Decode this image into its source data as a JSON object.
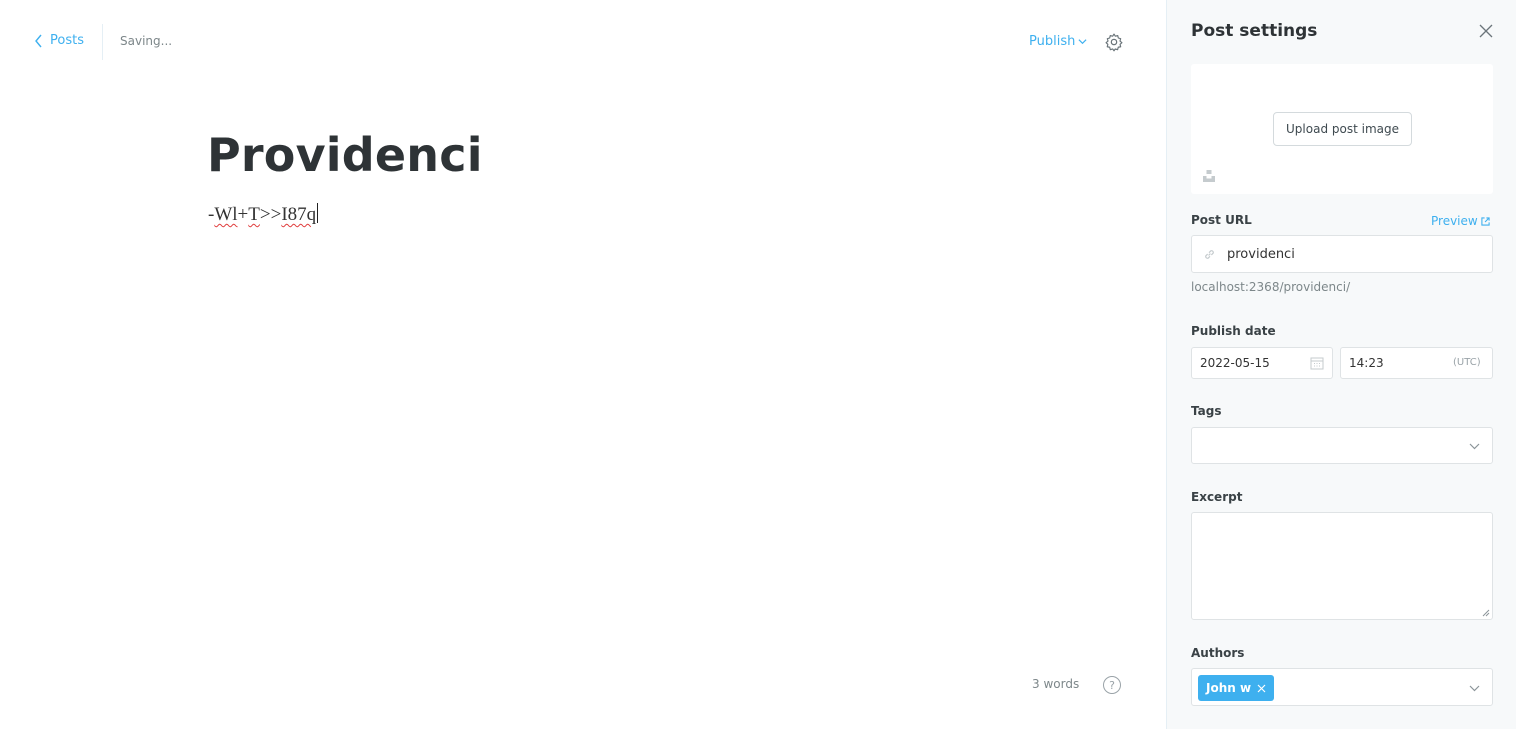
{
  "header": {
    "back_label": "Posts",
    "status": "Saving...",
    "publish_label": "Publish"
  },
  "post": {
    "title": "Providenci",
    "body_parts": [
      "-",
      "Wl",
      "+",
      "T",
      ">>",
      "I87q"
    ]
  },
  "footer": {
    "word_count": "3 words",
    "help_glyph": "?"
  },
  "settings": {
    "title": "Post settings",
    "upload_label": "Upload post image",
    "url_label": "Post URL",
    "preview_label": "Preview",
    "slug": "providenci",
    "url_hint": "localhost:2368/providenci/",
    "publish_date_label": "Publish date",
    "date": "2022-05-15",
    "time": "14:23",
    "timezone": "(UTC)",
    "tags_label": "Tags",
    "excerpt_label": "Excerpt",
    "excerpt_value": "",
    "authors_label": "Authors",
    "authors": [
      "John w"
    ]
  },
  "icons": {
    "back": "chevron-left-icon",
    "publish": "chevron-down-icon",
    "settings": "gear-icon",
    "close": "close-icon",
    "unsplash": "unsplash-icon",
    "preview": "external-link-icon",
    "link": "link-icon",
    "calendar": "calendar-icon",
    "help": "help-icon"
  },
  "colors": {
    "accent": "#3eb0ef",
    "panel_bg": "#f7f9fa",
    "title": "#2e3336"
  }
}
